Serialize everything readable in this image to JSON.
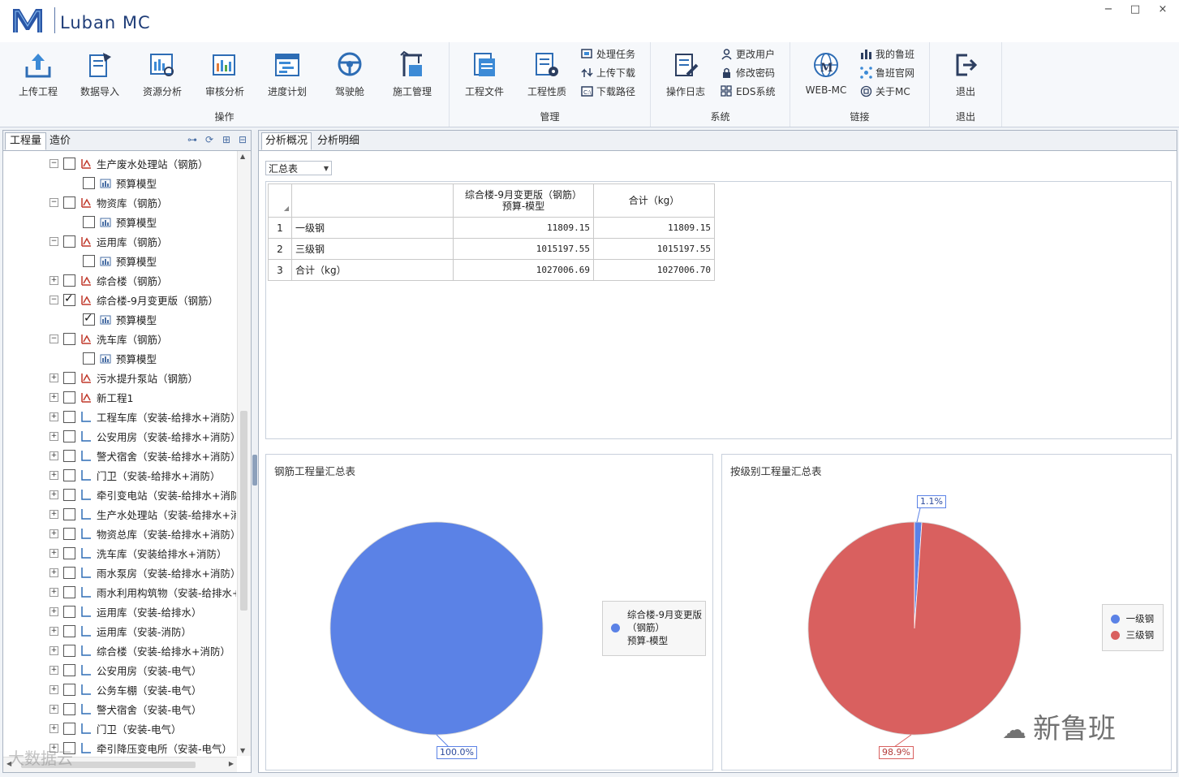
{
  "app": {
    "title": "Luban MC",
    "window_controls": [
      "−",
      "□",
      "×"
    ]
  },
  "ribbon": {
    "groups": [
      {
        "label": "操作",
        "buttons": [
          "上传工程",
          "数据导入",
          "资源分析",
          "审核分析",
          "进度计划",
          "驾驶舱",
          "施工管理"
        ]
      },
      {
        "label": "管理",
        "buttons": [
          "工程文件",
          "工程性质"
        ],
        "small": [
          "处理任务",
          "上传下载",
          "下载路径"
        ]
      },
      {
        "label": "系统",
        "buttons": [
          "操作日志"
        ],
        "small": [
          "更改用户",
          "修改密码",
          "EDS系统"
        ]
      },
      {
        "label": "链接",
        "buttons": [
          "WEB-MC"
        ],
        "small": [
          "我的鲁班",
          "鲁班官网",
          "关于MC"
        ]
      },
      {
        "label": "退出",
        "buttons": [
          "退出"
        ]
      }
    ]
  },
  "left_panel": {
    "tabs": [
      "工程量",
      "造价"
    ],
    "tree": [
      {
        "label": "生产废水处理站（钢筋）",
        "level": 0,
        "exp": "−",
        "checked": false,
        "icon": "rebar"
      },
      {
        "label": "预算模型",
        "level": 1,
        "checked": false,
        "icon": "model"
      },
      {
        "label": "物资库（钢筋）",
        "level": 0,
        "exp": "−",
        "checked": false,
        "icon": "rebar"
      },
      {
        "label": "预算模型",
        "level": 1,
        "checked": false,
        "icon": "model"
      },
      {
        "label": "运用库（钢筋）",
        "level": 0,
        "exp": "−",
        "checked": false,
        "icon": "rebar"
      },
      {
        "label": "预算模型",
        "level": 1,
        "checked": false,
        "icon": "model"
      },
      {
        "label": "综合楼（钢筋）",
        "level": 0,
        "exp": "+",
        "checked": false,
        "icon": "rebar"
      },
      {
        "label": "综合楼-9月变更版（钢筋）",
        "level": 0,
        "exp": "−",
        "checked": true,
        "icon": "rebar"
      },
      {
        "label": "预算模型",
        "level": 1,
        "checked": true,
        "icon": "model"
      },
      {
        "label": "洗车库（钢筋）",
        "level": 0,
        "exp": "−",
        "checked": false,
        "icon": "rebar"
      },
      {
        "label": "预算模型",
        "level": 1,
        "checked": false,
        "icon": "model"
      },
      {
        "label": "污水提升泵站（钢筋）",
        "level": 0,
        "exp": "+",
        "checked": false,
        "icon": "rebar"
      },
      {
        "label": "新工程1",
        "level": 0,
        "exp": "+",
        "checked": false,
        "icon": "rebar"
      },
      {
        "label": "工程车库（安装-给排水+消防）",
        "level": 0,
        "exp": "+",
        "checked": false,
        "icon": "install"
      },
      {
        "label": "公安用房（安装-给排水+消防）",
        "level": 0,
        "exp": "+",
        "checked": false,
        "icon": "install"
      },
      {
        "label": "警犬宿舍（安装-给排水+消防）",
        "level": 0,
        "exp": "+",
        "checked": false,
        "icon": "install"
      },
      {
        "label": "门卫（安装-给排水+消防）",
        "level": 0,
        "exp": "+",
        "checked": false,
        "icon": "install"
      },
      {
        "label": "牵引变电站（安装-给排水+消防",
        "level": 0,
        "exp": "+",
        "checked": false,
        "icon": "install"
      },
      {
        "label": "生产水处理站（安装-给排水+消",
        "level": 0,
        "exp": "+",
        "checked": false,
        "icon": "install"
      },
      {
        "label": "物资总库（安装-给排水+消防）",
        "level": 0,
        "exp": "+",
        "checked": false,
        "icon": "install"
      },
      {
        "label": "洗车库（安装给排水+消防）",
        "level": 0,
        "exp": "+",
        "checked": false,
        "icon": "install"
      },
      {
        "label": "雨水泵房（安装-给排水+消防）",
        "level": 0,
        "exp": "+",
        "checked": false,
        "icon": "install"
      },
      {
        "label": "雨水利用构筑物（安装-给排水+",
        "level": 0,
        "exp": "+",
        "checked": false,
        "icon": "install"
      },
      {
        "label": "运用库（安装-给排水）",
        "level": 0,
        "exp": "+",
        "checked": false,
        "icon": "install"
      },
      {
        "label": "运用库（安装-消防）",
        "level": 0,
        "exp": "+",
        "checked": false,
        "icon": "install"
      },
      {
        "label": "综合楼（安装-给排水+消防）",
        "level": 0,
        "exp": "+",
        "checked": false,
        "icon": "install"
      },
      {
        "label": "公安用房（安装-电气）",
        "level": 0,
        "exp": "+",
        "checked": false,
        "icon": "install"
      },
      {
        "label": "公务车棚（安装-电气）",
        "level": 0,
        "exp": "+",
        "checked": false,
        "icon": "install"
      },
      {
        "label": "警犬宿舍（安装-电气）",
        "level": 0,
        "exp": "+",
        "checked": false,
        "icon": "install"
      },
      {
        "label": "门卫（安装-电气）",
        "level": 0,
        "exp": "+",
        "checked": false,
        "icon": "install"
      },
      {
        "label": "牵引降压变电所（安装-电气）",
        "level": 0,
        "exp": "+",
        "checked": false,
        "icon": "install"
      }
    ]
  },
  "right_panel": {
    "tabs": [
      "分析概况",
      "分析明细"
    ],
    "combo_value": "汇总表",
    "grid": {
      "headers": [
        "",
        "",
        "综合楼-9月变更版（钢筋）\n预算-模型",
        "合计（kg）"
      ],
      "rows": [
        {
          "n": "1",
          "name": "一级钢",
          "v1": "11809.15",
          "v2": "11809.15"
        },
        {
          "n": "2",
          "name": "三级钢",
          "v1": "1015197.55",
          "v2": "1015197.55"
        },
        {
          "n": "3",
          "name": "合计（kg）",
          "v1": "1027006.69",
          "v2": "1027006.70"
        }
      ]
    }
  },
  "chart_data": [
    {
      "type": "pie",
      "title": "钢筋工程量汇总表",
      "categories": [
        "综合楼-9月变更版（钢筋）预算-模型"
      ],
      "values": [
        100.0
      ],
      "labels": [
        "100.0%"
      ],
      "legend": [
        "综合楼-9月变更版",
        "（钢筋）",
        "预算-模型"
      ],
      "colors": [
        "#5b82e6"
      ]
    },
    {
      "type": "pie",
      "title": "按级别工程量汇总表",
      "categories": [
        "一级钢",
        "三级钢"
      ],
      "values": [
        1.1,
        98.9
      ],
      "labels": [
        "1.1%",
        "98.9%"
      ],
      "colors": [
        "#5b82e6",
        "#d9605f"
      ]
    }
  ],
  "watermark": {
    "brand": "新鲁班",
    "corner": "大数据云"
  }
}
